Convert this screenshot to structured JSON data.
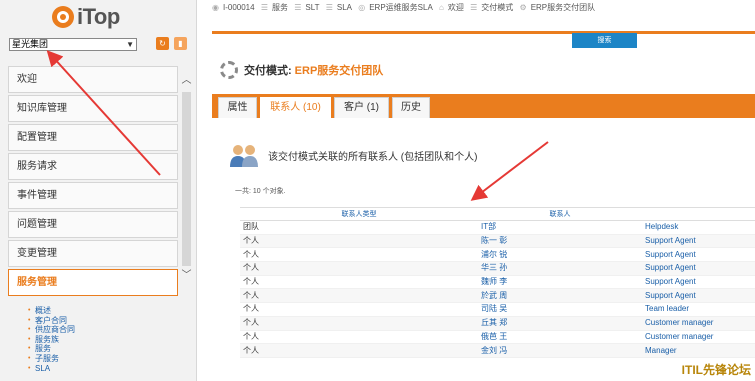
{
  "app": {
    "logo_text": "iTop",
    "org_selected": "星光集团",
    "menu": [
      {
        "label": "欢迎",
        "active": false
      },
      {
        "label": "知识库管理",
        "active": false
      },
      {
        "label": "配置管理",
        "active": false
      },
      {
        "label": "服务请求",
        "active": false
      },
      {
        "label": "事件管理",
        "active": false
      },
      {
        "label": "问题管理",
        "active": false
      },
      {
        "label": "变更管理",
        "active": false
      },
      {
        "label": "服务管理",
        "active": true
      }
    ],
    "submenu": [
      "概述",
      "客户合同",
      "供应商合同",
      "服务族",
      "服务",
      "子服务",
      "SLA"
    ]
  },
  "breadcrumb": [
    "I-000014",
    "服务",
    "SLT",
    "SLA",
    "ERP运维服务SLA",
    "欢迎",
    "交付模式",
    "ERP服务交付团队"
  ],
  "top_tab": "搜索",
  "page": {
    "title_prefix": "交付模式:",
    "title_value": "ERP服务交付团队",
    "tabs": [
      {
        "label": "属性",
        "active": false
      },
      {
        "label": "联系人 (10)",
        "active": true
      },
      {
        "label": "客户 (1)",
        "active": false
      },
      {
        "label": "历史",
        "active": false
      }
    ],
    "list_heading": "该交付模式关联的所有联系人 (包括团队和个人)",
    "count_text": "一共: 10 个对象.",
    "table": {
      "headers": [
        "联系人类型",
        "联系人",
        ""
      ],
      "rows": [
        [
          "团队",
          "IT部",
          "Helpdesk"
        ],
        [
          "个人",
          "陈一 彰",
          "Support Agent"
        ],
        [
          "个人",
          "浦尔 锐",
          "Support Agent"
        ],
        [
          "个人",
          "华三 孙",
          "Support Agent"
        ],
        [
          "个人",
          "魏师 李",
          "Support Agent"
        ],
        [
          "个人",
          "於武 周",
          "Support Agent"
        ],
        [
          "个人",
          "司陆 吴",
          "Team leader"
        ],
        [
          "个人",
          "丘其 郑",
          "Customer manager"
        ],
        [
          "个人",
          "俄芭 王",
          "Customer manager"
        ],
        [
          "个人",
          "金刘 冯",
          "Manager"
        ]
      ]
    }
  },
  "watermark": "ITIL先锋论坛",
  "colors": {
    "accent": "#ea7d1e",
    "link": "#1a5fa8",
    "tab_blue": "#1d85c6",
    "arrow": "#e53935"
  }
}
